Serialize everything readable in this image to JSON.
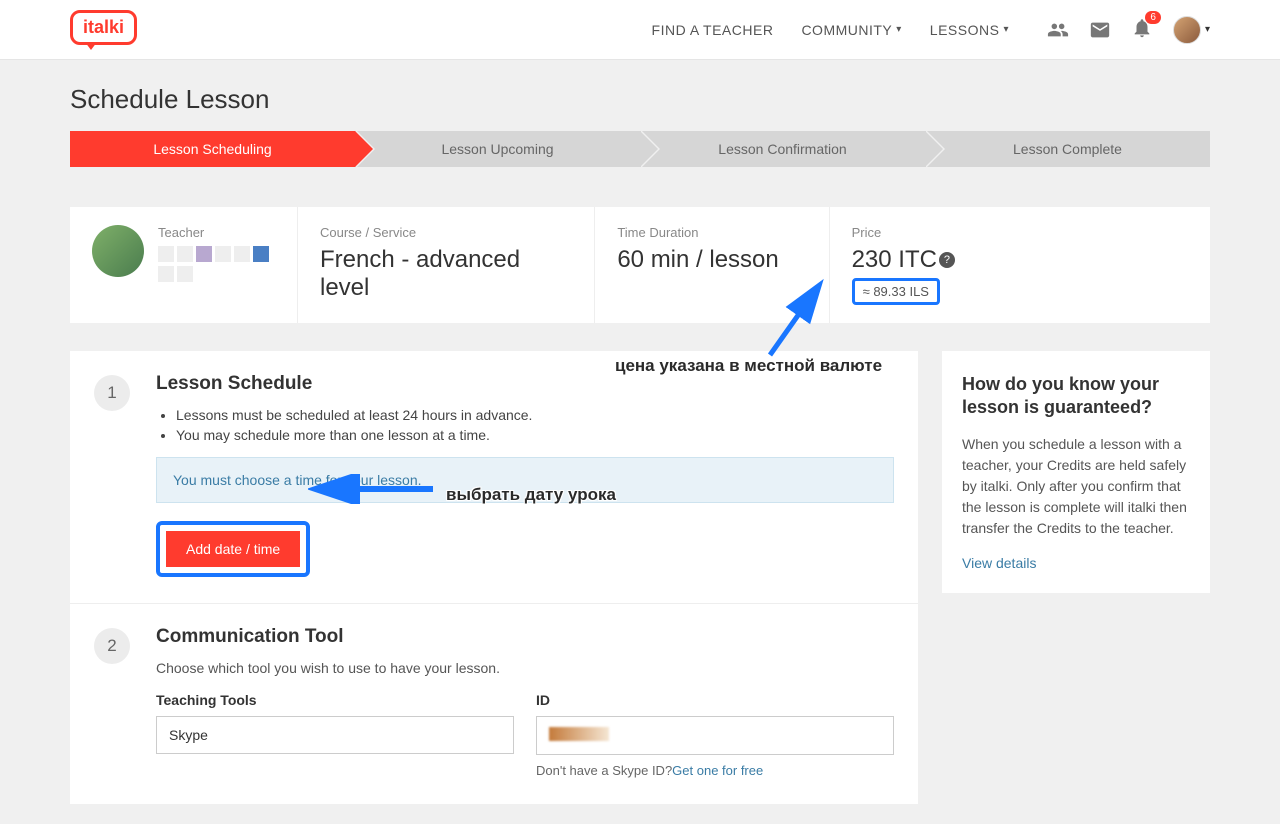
{
  "header": {
    "logo_text": "italki",
    "nav": {
      "find_teacher": "FIND A TEACHER",
      "community": "COMMUNITY",
      "lessons": "LESSONS"
    },
    "notification_count": "6"
  },
  "page": {
    "title": "Schedule Lesson"
  },
  "steps": [
    {
      "label": "Lesson Scheduling",
      "active": true
    },
    {
      "label": "Lesson Upcoming",
      "active": false
    },
    {
      "label": "Lesson Confirmation",
      "active": false
    },
    {
      "label": "Lesson Complete",
      "active": false
    }
  ],
  "summary": {
    "teacher_label": "Teacher",
    "course_label": "Course / Service",
    "course_value": "French - advanced level",
    "duration_label": "Time Duration",
    "duration_value": "60 min / lesson",
    "price_label": "Price",
    "price_value": "230 ITC",
    "price_approx": "≈ 89.33 ILS"
  },
  "section1": {
    "num": "1",
    "title": "Lesson Schedule",
    "bullet1": "Lessons must be scheduled at least 24 hours in advance.",
    "bullet2": "You may schedule more than one lesson at a time.",
    "info": "You must choose a time for your lesson.",
    "add_btn": "Add date / time"
  },
  "section2": {
    "num": "2",
    "title": "Communication Tool",
    "desc": "Choose which tool you wish to use to have your lesson.",
    "tools_label": "Teaching Tools",
    "tools_value": "Skype",
    "id_label": "ID",
    "skype_note_pre": "Don't have a Skype ID?",
    "skype_note_link": "Get one for free"
  },
  "sidebar": {
    "title": "How do you know your lesson is guaranteed?",
    "text": "When you schedule a lesson with a teacher, your Credits are held safely by italki. Only after you confirm that the lesson is complete will italki then transfer the Credits to the teacher.",
    "link": "View details"
  },
  "annotations": {
    "price": "цена указана в местной валюте",
    "date": "выбрать дату урока"
  }
}
